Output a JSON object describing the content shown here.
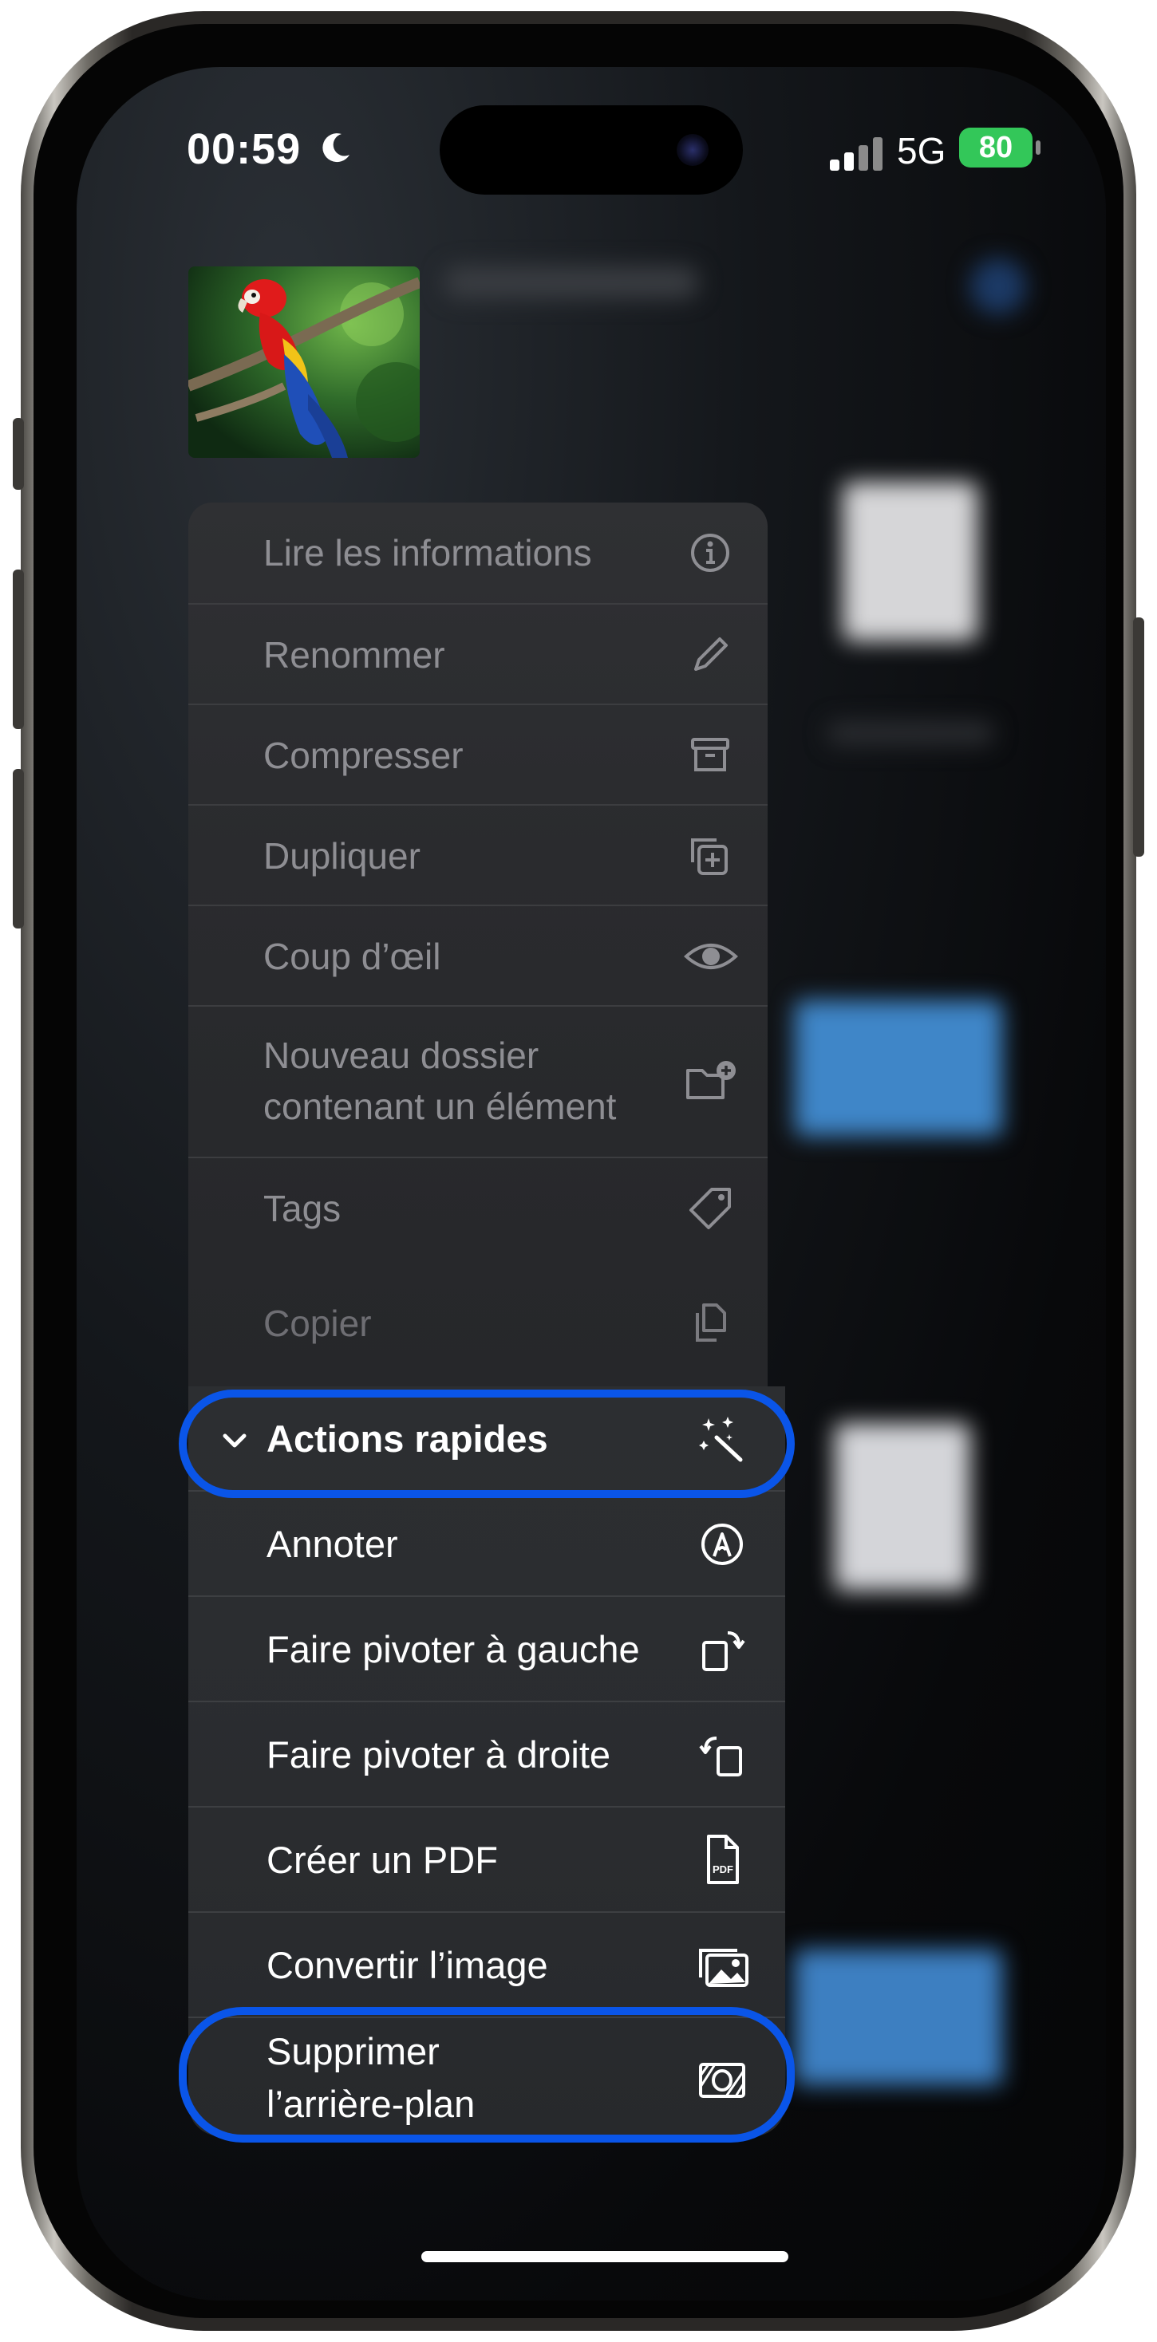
{
  "status_bar": {
    "time": "00:59",
    "network": "5G",
    "battery": "80",
    "icons": [
      "moon-icon",
      "signal-icon",
      "battery-icon"
    ]
  },
  "context_menu": {
    "items": [
      {
        "label": "Lire les informations",
        "icon": "info-icon"
      },
      {
        "label": "Renommer",
        "icon": "pencil-icon"
      },
      {
        "label": "Compresser",
        "icon": "archive-icon"
      },
      {
        "label": "Dupliquer",
        "icon": "duplicate-icon"
      },
      {
        "label": "Coup d’œil",
        "icon": "eye-icon"
      },
      {
        "label_line1": "Nouveau dossier",
        "label_line2": "contenant un élément",
        "icon": "folder-plus-icon"
      },
      {
        "label": "Tags",
        "icon": "tag-icon"
      },
      {
        "label": "Copier",
        "icon": "copy-icon"
      }
    ]
  },
  "quick_actions": {
    "header": {
      "label": "Actions rapides",
      "icon": "magic-wand-icon",
      "chevron": "chevron-down-icon"
    },
    "items": [
      {
        "label": "Annoter",
        "icon": "markup-icon"
      },
      {
        "label": "Faire pivoter à gauche",
        "icon": "rotate-left-icon"
      },
      {
        "label": "Faire pivoter à droite",
        "icon": "rotate-right-icon"
      },
      {
        "label": "Créer un PDF",
        "icon": "pdf-icon",
        "icon_text": "PDF"
      },
      {
        "label": "Convertir l’image",
        "icon": "photos-icon"
      },
      {
        "label_line1": "Supprimer",
        "label_line2": "l’arrière-plan",
        "icon": "remove-background-icon"
      }
    ]
  },
  "colors": {
    "highlight": "#0a55e8",
    "battery": "#33c759",
    "menu_text_dim": "#8e8e93",
    "menu_text": "#ffffff"
  }
}
